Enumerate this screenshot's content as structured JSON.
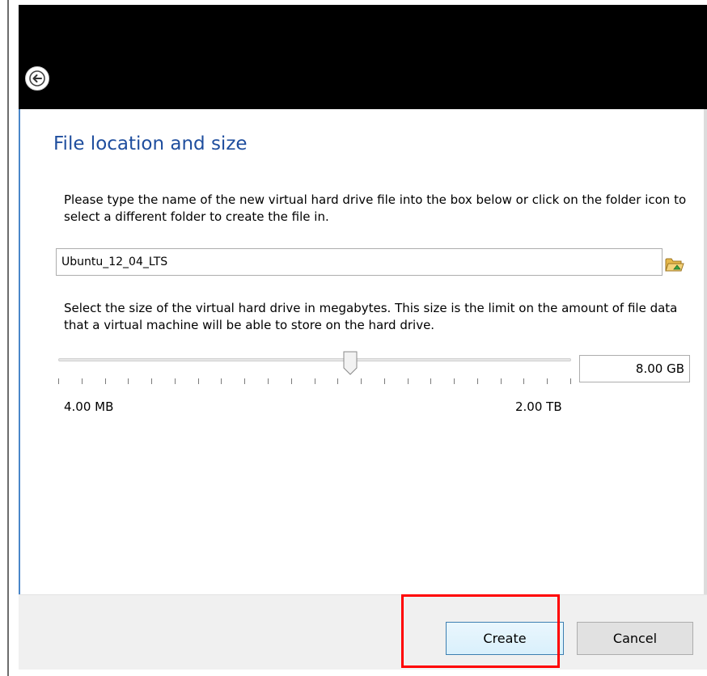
{
  "dialog": {
    "title": "File location and size",
    "instructions": "Please type the name of the new virtual hard drive file into the box below or click on the folder icon to select a different folder to create the file in.",
    "file_name": "Ubuntu_12_04_LTS",
    "size_instructions": "Select the size of the virtual hard drive in megabytes. This size is the limit on the amount of file data that a virtual machine will be able to store on the hard drive.",
    "size_value": "8.00 GB",
    "size_min_label": "4.00 MB",
    "size_max_label": "2.00 TB",
    "slider_position_fraction": 0.57
  },
  "footer": {
    "create_label": "Create",
    "cancel_label": "Cancel"
  },
  "icons": {
    "back": "back-arrow-icon",
    "folder": "folder-icon"
  },
  "colors": {
    "header": "#000000",
    "title": "#1f4e9e",
    "highlight": "#ff0000"
  }
}
